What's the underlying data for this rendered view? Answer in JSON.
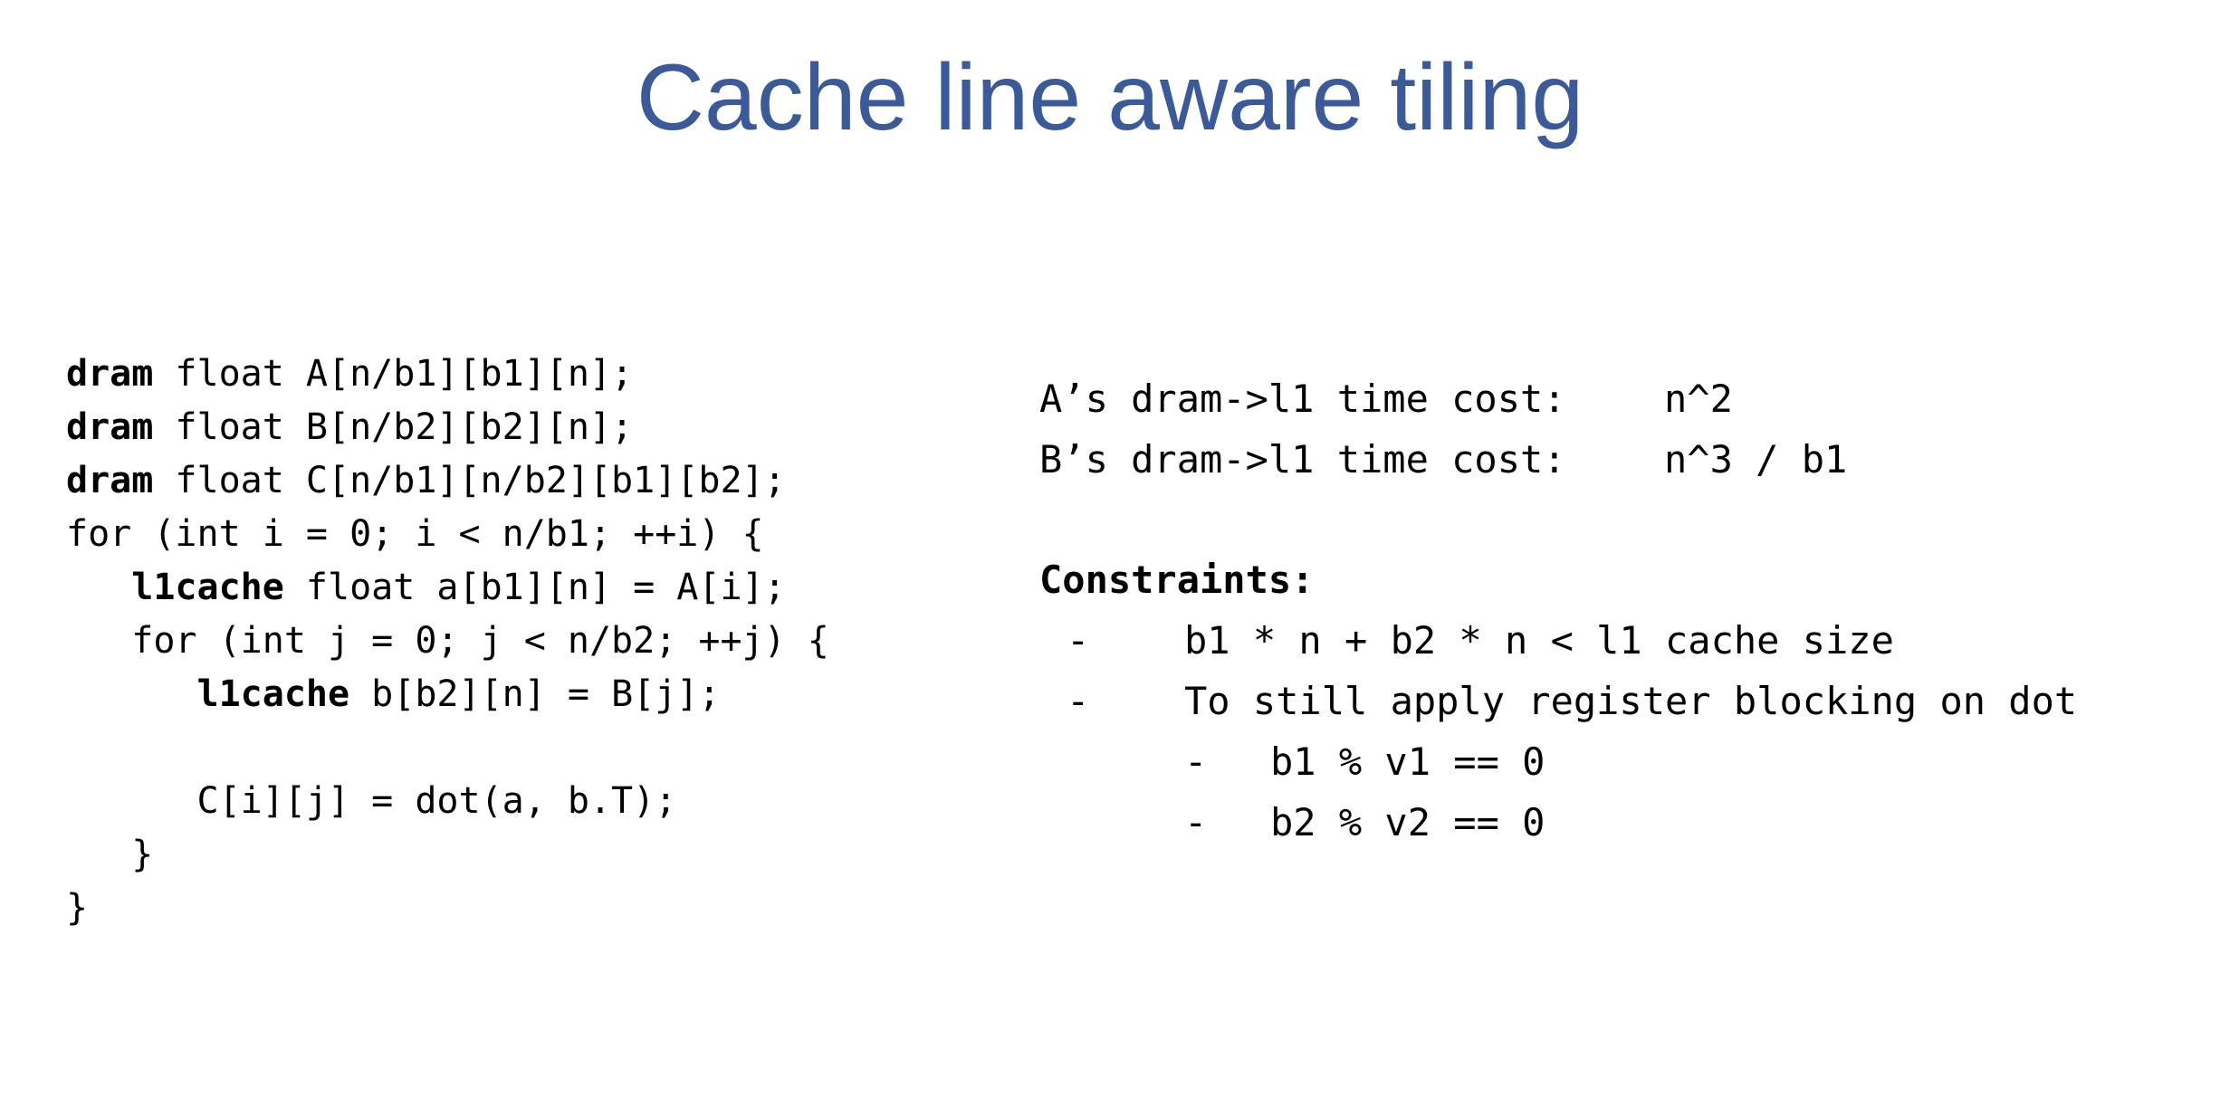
{
  "title": "Cache line aware tiling",
  "code": {
    "lines": [
      {
        "kw": "dram",
        "rest": " float A[n/b1][b1][n];",
        "indent": ""
      },
      {
        "kw": "dram",
        "rest": " float B[n/b2][b2][n];",
        "indent": ""
      },
      {
        "kw": "dram",
        "rest": " float C[n/b1][n/b2][b1][b2];",
        "indent": ""
      },
      {
        "kw": "",
        "rest": "for (int i = 0; i < n/b1; ++i) {",
        "indent": ""
      },
      {
        "kw": "l1cache",
        "rest": " float a[b1][n] = A[i];",
        "indent": "   "
      },
      {
        "kw": "",
        "rest": "for (int j = 0; j < n/b2; ++j) {",
        "indent": "   "
      },
      {
        "kw": "l1cache",
        "rest": " b[b2][n] = B[j];",
        "indent": "      "
      },
      {
        "kw": "",
        "rest": "",
        "indent": ""
      },
      {
        "kw": "",
        "rest": "C[i][j] = dot(a, b.T);",
        "indent": "      "
      },
      {
        "kw": "",
        "rest": "}",
        "indent": "   "
      },
      {
        "kw": "",
        "rest": "}",
        "indent": ""
      }
    ]
  },
  "costs": [
    {
      "label": "A’s dram->l1 time cost:",
      "value": "n^2"
    },
    {
      "label": "B’s dram->l1 time cost:",
      "value": "n^3 / b1"
    }
  ],
  "constraints": {
    "title": "Constraints:",
    "items": [
      {
        "dash": "-",
        "text": "b1 * n + b2 * n < l1 cache size",
        "level": 1
      },
      {
        "dash": "-",
        "text": "To still apply register blocking on dot",
        "level": 1
      },
      {
        "dash": "-",
        "text": "b1 % v1 == 0",
        "level": 2
      },
      {
        "dash": "-",
        "text": "b2 % v2 == 0",
        "level": 2
      }
    ]
  }
}
